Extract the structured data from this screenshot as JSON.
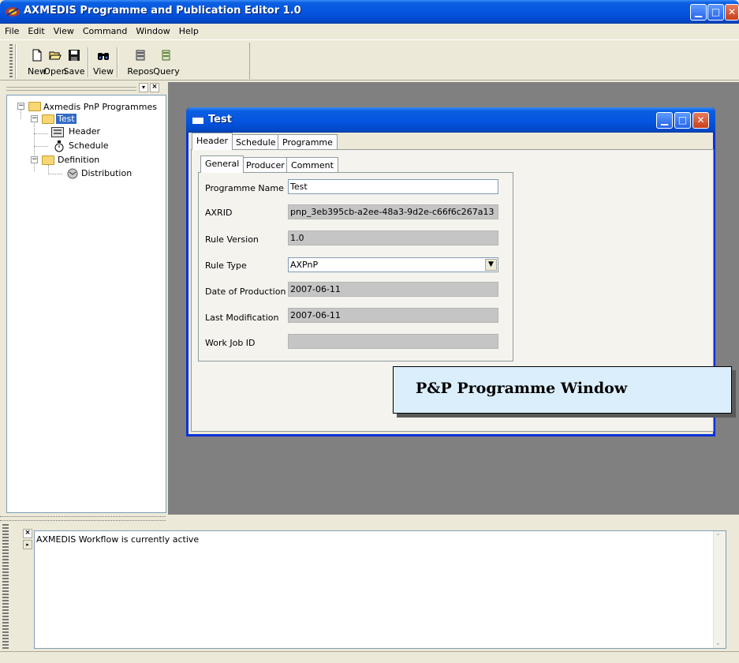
{
  "app": {
    "title": "AXMEDIS Programme and Publication Editor 1.0"
  },
  "menu": {
    "items": [
      "File",
      "Edit",
      "View",
      "Command",
      "Window",
      "Help"
    ]
  },
  "toolbar": {
    "new_label": "New",
    "open_label": "Open",
    "save_label": "Save",
    "view_label": "View",
    "repos_label": "Repos",
    "query_label": "Query"
  },
  "tree": {
    "root": "Axmedis PnP Programmes",
    "programme": "Test",
    "header": "Header",
    "schedule": "Schedule",
    "definition": "Definition",
    "distribution": "Distribution"
  },
  "child_window": {
    "title": "Test",
    "tabs": [
      "Header",
      "Schedule",
      "Programme"
    ],
    "subtabs": [
      "General",
      "Producer",
      "Comment"
    ],
    "fields": {
      "programme_name_label": "Programme Name",
      "programme_name_value": "Test",
      "axrid_label": "AXRID",
      "axrid_value": "pnp_3eb395cb-a2ee-48a3-9d2e-c66f6c267a13",
      "rule_version_label": "Rule Version",
      "rule_version_value": "1.0",
      "rule_type_label": "Rule Type",
      "rule_type_value": "AXPnP",
      "date_of_production_label": "Date of Production",
      "date_of_production_value": "2007-06-11",
      "last_modification_label": "Last Modification",
      "last_modification_value": "2007-06-11",
      "work_job_id_label": "Work Job ID",
      "work_job_id_value": ""
    }
  },
  "callout": {
    "text": "P&P Programme Window"
  },
  "output": {
    "message": "AXMEDIS Workflow is currently active"
  },
  "colors": {
    "titlebar": "#0554e0",
    "workspace": "#808080",
    "callout_bg": "#dbeefc",
    "readonly_field": "#c5c5c5"
  }
}
